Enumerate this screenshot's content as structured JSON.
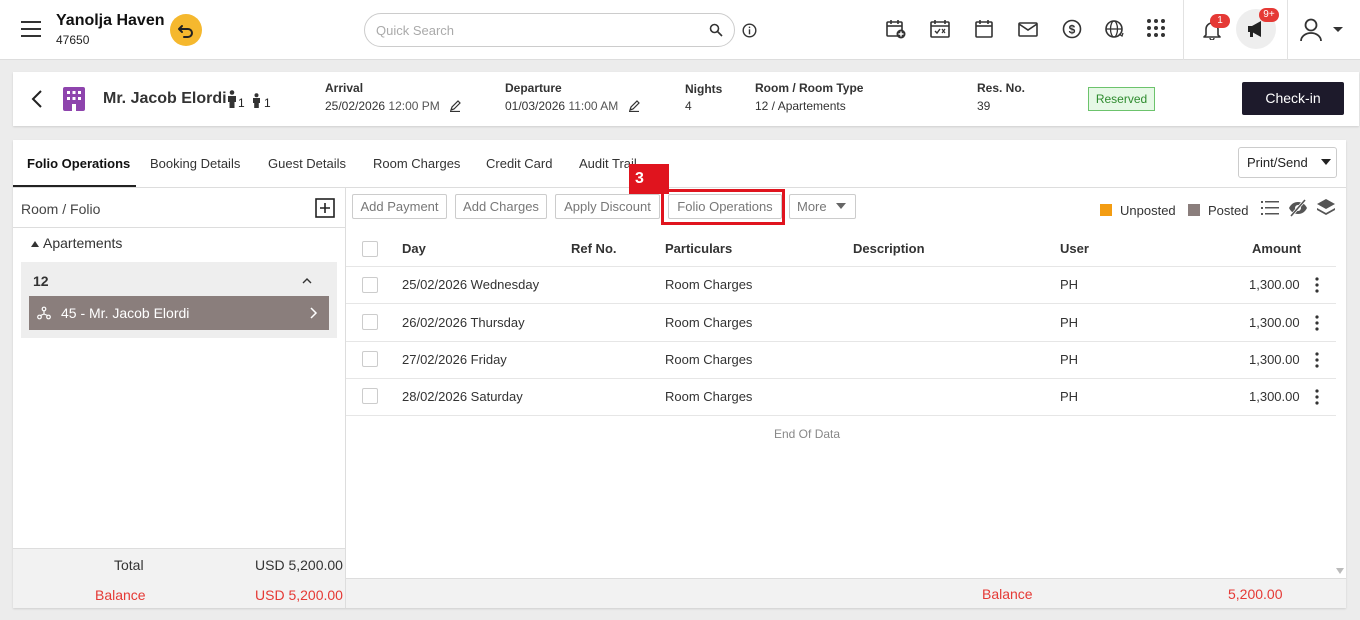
{
  "topbar": {
    "hotel_name": "Yanolja Haven",
    "hotel_code": "47650",
    "search_placeholder": "Quick Search",
    "notification_count": "1",
    "announcement_count": "9+"
  },
  "reservation": {
    "guest_name": "Mr. Jacob Elordi",
    "adults": "1",
    "children": "1",
    "arrival_label": "Arrival",
    "arrival_date": "25/02/2026",
    "arrival_time": "12:00 PM",
    "departure_label": "Departure",
    "departure_date": "01/03/2026",
    "departure_time": "11:00 AM",
    "nights_label": "Nights",
    "nights": "4",
    "room_label": "Room / Room Type",
    "room_value": "12 / Apartements",
    "resno_label": "Res. No.",
    "resno": "39",
    "status": "Reserved",
    "checkin_label": "Check-in"
  },
  "tabs": [
    "Folio Operations",
    "Booking Details",
    "Guest Details",
    "Room Charges",
    "Credit Card",
    "Audit Trail"
  ],
  "print_label": "Print/Send",
  "left_panel": {
    "title": "Room / Folio",
    "group": "Apartements",
    "room": "12",
    "folio": "45 - Mr. Jacob Elordi",
    "total_label": "Total",
    "total_value": "USD 5,200.00",
    "balance_label": "Balance",
    "balance_value": "USD 5,200.00"
  },
  "actions": {
    "add_payment": "Add Payment",
    "add_charges": "Add Charges",
    "apply_discount": "Apply Discount",
    "folio_operations": "Folio Operations",
    "more": "More",
    "step_marker": "3"
  },
  "legend": {
    "unposted": "Unposted",
    "posted": "Posted",
    "unposted_color": "#f39c12",
    "posted_color": "#8a7e7c"
  },
  "table": {
    "headers": {
      "day": "Day",
      "ref": "Ref No.",
      "particulars": "Particulars",
      "description": "Description",
      "user": "User",
      "amount": "Amount"
    },
    "rows": [
      {
        "day": "25/02/2026 Wednesday",
        "particulars": "Room Charges",
        "user": "PH",
        "amount": "1,300.00"
      },
      {
        "day": "26/02/2026 Thursday",
        "particulars": "Room Charges",
        "user": "PH",
        "amount": "1,300.00"
      },
      {
        "day": "27/02/2026 Friday",
        "particulars": "Room Charges",
        "user": "PH",
        "amount": "1,300.00"
      },
      {
        "day": "28/02/2026 Saturday",
        "particulars": "Room Charges",
        "user": "PH",
        "amount": "1,300.00"
      }
    ],
    "end_text": "End Of Data",
    "balance_label": "Balance",
    "balance_value": "5,200.00"
  }
}
